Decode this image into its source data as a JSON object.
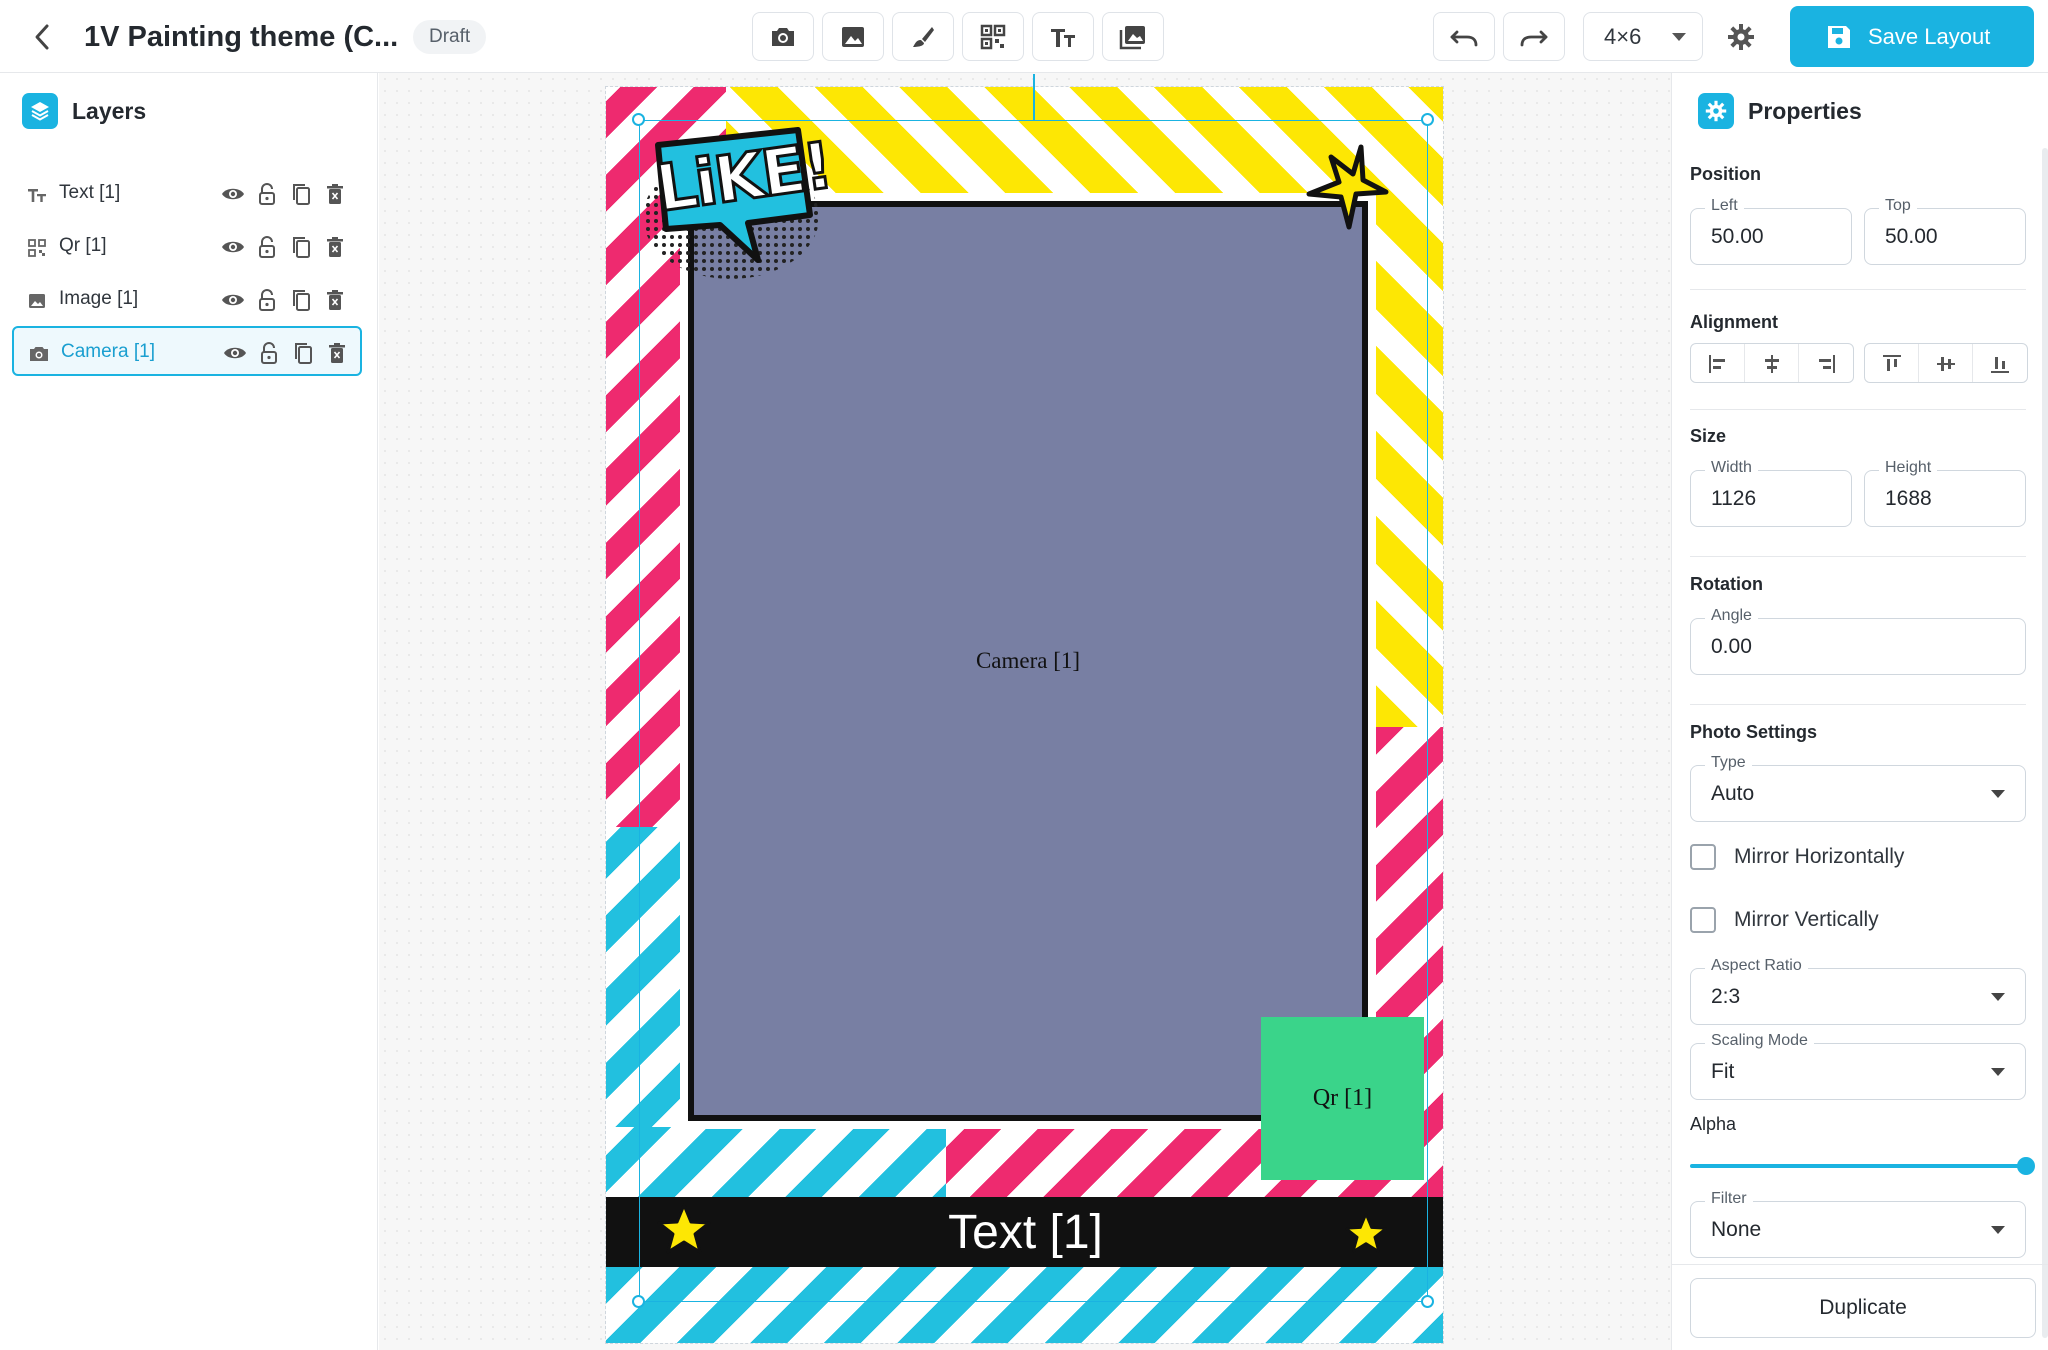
{
  "header": {
    "title": "1V Painting theme (C...",
    "status_badge": "Draft",
    "tools": [
      {
        "name": "camera-tool",
        "icon": "camera-icon"
      },
      {
        "name": "image-tool",
        "icon": "image-icon"
      },
      {
        "name": "brush-tool",
        "icon": "brush-icon"
      },
      {
        "name": "qr-tool",
        "icon": "qr-icon"
      },
      {
        "name": "text-tool",
        "icon": "text-icon"
      },
      {
        "name": "gallery-tool",
        "icon": "gallery-icon"
      }
    ],
    "size_select": "4×6",
    "save_label": "Save Layout"
  },
  "layers_panel": {
    "title": "Layers",
    "items": [
      {
        "label": "Text [1]",
        "icon": "text-icon",
        "selected": false
      },
      {
        "label": "Qr [1]",
        "icon": "qr-icon",
        "selected": false
      },
      {
        "label": "Image [1]",
        "icon": "image-icon",
        "selected": false
      },
      {
        "label": "Camera [1]",
        "icon": "camera-icon",
        "selected": true
      }
    ]
  },
  "canvas": {
    "camera_label": "Camera [1]",
    "qr_label": "Qr [1]",
    "text_label": "Text [1]",
    "sticker_text": "LiKE!"
  },
  "properties": {
    "title": "Properties",
    "position": {
      "title": "Position",
      "left_label": "Left",
      "left_value": "50.00",
      "top_label": "Top",
      "top_value": "50.00"
    },
    "alignment": {
      "title": "Alignment"
    },
    "size": {
      "title": "Size",
      "width_label": "Width",
      "width_value": "1126",
      "height_label": "Height",
      "height_value": "1688"
    },
    "rotation": {
      "title": "Rotation",
      "angle_label": "Angle",
      "angle_value": "0.00"
    },
    "photo": {
      "title": "Photo Settings",
      "type_label": "Type",
      "type_value": "Auto",
      "mirror_h": "Mirror Horizontally",
      "mirror_v": "Mirror Vertically",
      "aspect_label": "Aspect Ratio",
      "aspect_value": "2:3",
      "scaling_label": "Scaling Mode",
      "scaling_value": "Fit",
      "alpha_label": "Alpha",
      "alpha_value": 1.0,
      "filter_label": "Filter",
      "filter_value": "None"
    },
    "duplicate_label": "Duplicate"
  },
  "colors": {
    "accent": "#1ab3e1",
    "yellow": "#fde704",
    "pink": "#ee2a6f",
    "cyan": "#22c0df",
    "photo": "#787fa3",
    "qr": "#3ad48a"
  }
}
